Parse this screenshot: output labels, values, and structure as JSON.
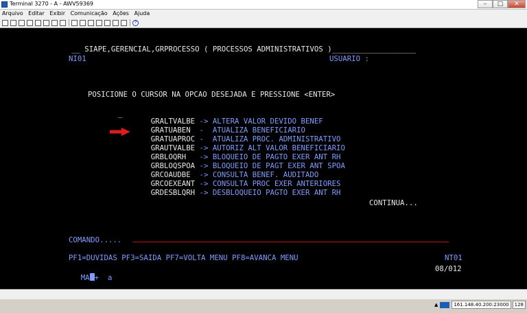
{
  "window": {
    "title": "Terminal 3270 - A - AWV59369",
    "minimize": "–",
    "maximize": "□",
    "close": "✕"
  },
  "menu": [
    "Arquivo",
    "Editar",
    "Exibir",
    "Comunicação",
    "Ações",
    "Ajuda"
  ],
  "terminal": {
    "header": "__ SIAPE,GERENCIAL,GRPROCESSO ( PROCESSOS ADMINISTRATIVOS )___________________",
    "screen_id": "NI01",
    "usuario": "USUARIO :",
    "instruction": "POSICIONE O CURSOR NA OPCAO DESEJADA E PRESSIONE <ENTER>",
    "cursor_mark": "_",
    "options": [
      {
        "code": "GRALTVALBE",
        "sep": "->",
        "desc": "ALTERA VALOR DEVIDO BENEF"
      },
      {
        "code": "GRATUABEN",
        "sep": "-",
        "desc": "ATUALIZA BENEFICIARIO"
      },
      {
        "code": "GRATUAPROC",
        "sep": "-",
        "desc": "ATUALIZA PROC. ADMINISTRATIVO"
      },
      {
        "code": "GRAUTVALBE",
        "sep": "->",
        "desc": "AUTORIZ ALT VALOR BENEFICIARIO"
      },
      {
        "code": "GRBLOQRH",
        "sep": "->",
        "desc": "BLOQUEIO DE PAGTO EXER ANT RH"
      },
      {
        "code": "GRBLOQSPOA",
        "sep": "->",
        "desc": "BLOQUEIO DE PAGT EXER ANT SPOA"
      },
      {
        "code": "GRCOAUDBE",
        "sep": "->",
        "desc": "CONSULTA BENEF. AUDITADO"
      },
      {
        "code": "GRCOEXEANT",
        "sep": "->",
        "desc": "CONSULTA PROC EXER ANTERIORES"
      },
      {
        "code": "GRDESBLQRH",
        "sep": "->",
        "desc": "DESBLOQUEIO PAGTO EXER ANT RH"
      }
    ],
    "continua": "CONTINUA...",
    "comando": "COMANDO.....",
    "pf_keys": "PF1=DUVIDAS PF3=SAIDA PF7=VOLTA MENU PF8=AVANCA MENU",
    "nt": "NT01",
    "oia_left": "MA",
    "oia_plus": "+",
    "oia_a": "a",
    "oia_pos": "08/012"
  },
  "status": {
    "host": "161.148.40.200:23000",
    "session": "128"
  },
  "colors": {
    "background": "#000000",
    "text": "#e8e8e8",
    "field": "#7f9dff",
    "marker": "#ff3030"
  }
}
